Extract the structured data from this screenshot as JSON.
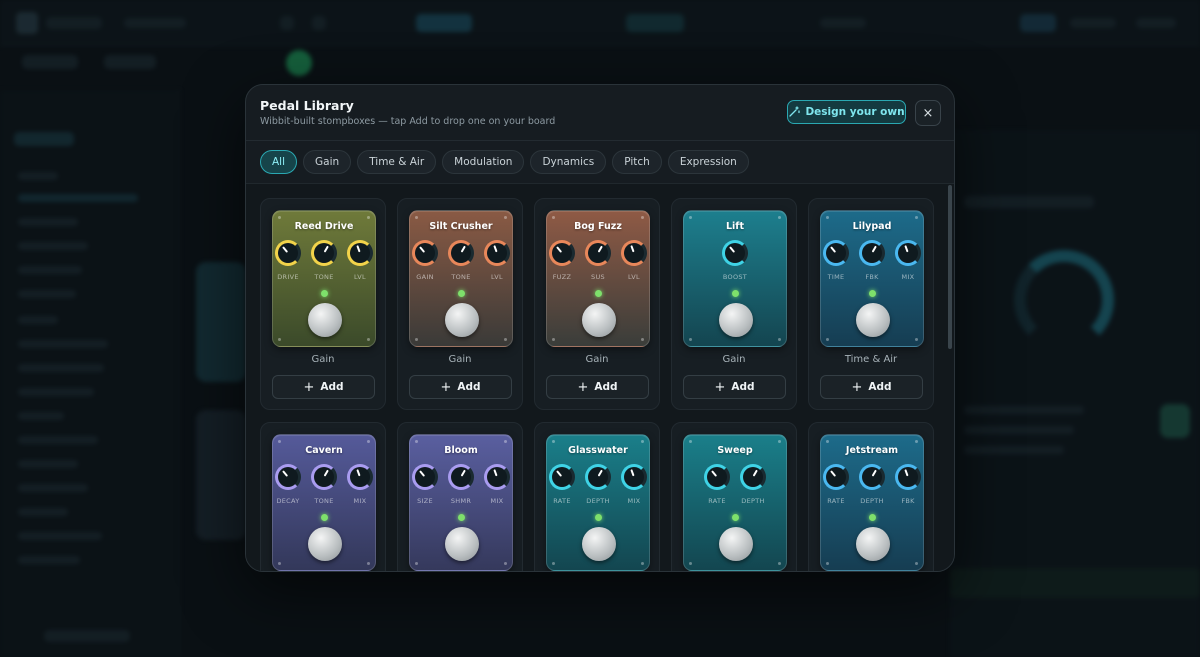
{
  "modal": {
    "title": "Pedal Library",
    "subtitle": "Wibbit-built stompboxes — tap Add to drop one on your board",
    "design_label": "Design your own",
    "close_symbol": "×"
  },
  "filters": [
    {
      "label": "All",
      "active": true
    },
    {
      "label": "Gain",
      "active": false
    },
    {
      "label": "Time & Air",
      "active": false
    },
    {
      "label": "Modulation",
      "active": false
    },
    {
      "label": "Dynamics",
      "active": false
    },
    {
      "label": "Pitch",
      "active": false
    },
    {
      "label": "Expression",
      "active": false
    }
  ],
  "add_label": "Add",
  "pedals": [
    {
      "name": "Reed Drive",
      "category": "Gain",
      "color_top": "#6f7a3a",
      "color_bottom": "#3b4a2a",
      "ring": "#f2d34a",
      "knobs": [
        "DRIVE",
        "TONE",
        "LVL"
      ]
    },
    {
      "name": "Silt Crusher",
      "category": "Gain",
      "color_top": "#8a5a44",
      "color_bottom": "#3a3a38",
      "ring": "#e8875a",
      "knobs": [
        "GAIN",
        "TONE",
        "LVL"
      ]
    },
    {
      "name": "Bog Fuzz",
      "category": "Gain",
      "color_top": "#8f5a45",
      "color_bottom": "#3a3d3a",
      "ring": "#e8875a",
      "knobs": [
        "FUZZ",
        "SUS",
        "LVL"
      ]
    },
    {
      "name": "Lift",
      "category": "Gain",
      "color_top": "#1d7f8e",
      "color_bottom": "#144550",
      "ring": "#3fd3e6",
      "knobs": [
        "BOOST"
      ]
    },
    {
      "name": "Lilypad",
      "category": "Time & Air",
      "color_top": "#1d6b8a",
      "color_bottom": "#163d52",
      "ring": "#4ab8f0",
      "knobs": [
        "TIME",
        "FBK",
        "MIX"
      ]
    },
    {
      "name": "Cavern",
      "category": "",
      "color_top": "#555a9a",
      "color_bottom": "#33385a",
      "ring": "#a99cf0",
      "knobs": [
        "DECAY",
        "TONE",
        "MIX"
      ]
    },
    {
      "name": "Bloom",
      "category": "",
      "color_top": "#5a5fa0",
      "color_bottom": "#35395c",
      "ring": "#a99cf0",
      "knobs": [
        "SIZE",
        "SHMR",
        "MIX"
      ]
    },
    {
      "name": "Glasswater",
      "category": "",
      "color_top": "#1a7f8a",
      "color_bottom": "#134650",
      "ring": "#3fd3e6",
      "knobs": [
        "RATE",
        "DEPTH",
        "MIX"
      ]
    },
    {
      "name": "Sweep",
      "category": "",
      "color_top": "#1a7f8a",
      "color_bottom": "#134650",
      "ring": "#3fd3e6",
      "knobs": [
        "RATE",
        "DEPTH"
      ]
    },
    {
      "name": "Jetstream",
      "category": "",
      "color_top": "#1d6b8a",
      "color_bottom": "#163d52",
      "ring": "#4ab8f0",
      "knobs": [
        "RATE",
        "DEPTH",
        "FBK"
      ]
    }
  ]
}
